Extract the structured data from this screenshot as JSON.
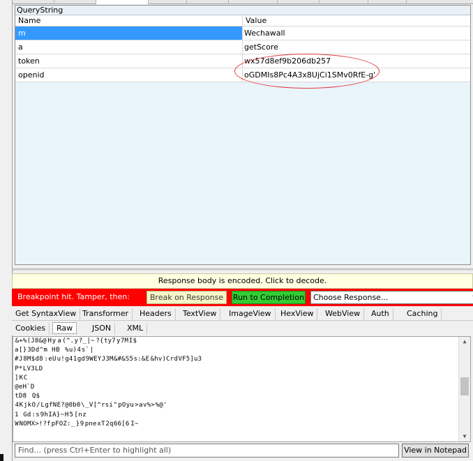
{
  "querystring": {
    "title": "QueryString",
    "columns": [
      "Name",
      "Value"
    ],
    "rows": [
      {
        "name": "m",
        "value": "Wechawall"
      },
      {
        "name": "a",
        "value": "getScore"
      },
      {
        "name": "token",
        "value": "wx57d8ef9b206db257"
      },
      {
        "name": "openid",
        "value": "oGDMIs8Pc4A3x8UjCi1SMv0RfE-g'"
      }
    ]
  },
  "response": {
    "encoded_notice": "Response body is encoded. Click to decode.",
    "breakpoint_label": "Breakpoint hit. Tamper, then:",
    "break_button": "Break on Response",
    "run_button": "Run to Completion",
    "choose_response": "Choose Response...",
    "tabs_row1": [
      "Get SyntaxView",
      "Transformer",
      "Headers",
      "TextView",
      "ImageView",
      "HexView",
      "WebView",
      "Auth",
      "Caching"
    ],
    "tabs_row2": [
      "Cookies",
      "Raw",
      "JSON",
      "XML"
    ],
    "active_tab": "Raw",
    "raw_lines": [
      "\u0001\u0001\u0001&+%\u0001(J8&@\u0001\u0001\u0001\u0001\u0001\u0001\u0001\u0001\u0001H\u0001\u0001\u0001y\u0001\u0001\u0001\u0001\u0001\u0001\u0001\u0001\u0001\u0001a\u0001\u0001\u0001\u0001\u0001\u0001(\u0001^.\u0001y\u0001\u0001\u0001\u0001?_\u0001\u0001|~\u0001\u0001\u0001\u0001\u0001\u0001\u0001\u0001?{\u0001\u0001ty7\u0001\u0001\u0001\u0001\u0001\u0001y\u00017M\u0001\u0001\u0001\u0001I$\u0001\u0001\u0001",
      "a\u0001\u0001[\u0001}\u0001\u0001\u0001\u00013D\u0001d\u0001\u0001^\u0001m \u0001\u0001H\u0001\u0001B\u0001\u0001\u0001 \u0001\u0001\u0001\u0001\u0001%\u0001u)\u0001\u00014\u0001\u0001\u0001\u0001s`\u0001\u0001\u0001|\u0001\u0001\u0001\u0001",
      "#\u0001\u0001J\u0001\u0001\u0001\u00018M$\u0001d8\u0001\u0001\u0001\u0001\u0001\u0001\u0001\u0001:\u0001\u0001eU\u0001\u0001\u0001\u0001\u0001u!\u0001\u0001g4\u0001\u00011\u0001\u0001gd\u0001\u0001\u00019W\u0001EY\u0001J\u00013M\u0001&#&\u0001S5\u0001\u0001s:&\u0001E\u0001\u0001\u0001\u0001\u0001\u0001\u0001&hv)Cr\u0001d\u0001\u0001VF5]u3",
      "\u0001\u0001P*\u0001L\u0001V3\u0001LD\u0001",
      "]\u0001\u0001\u0001\u0001\u0001K\u0001\u0001\u0001C",
      "\u0001@\u0001eH`D\u0001",
      "\u0001\u0001tD8\u0001\u0001\u0001\u0001\u0001\u0001\u0001\u0001  \u0001\u0001Q$\u0001\u0001",
      "\u0001\u0001\u00014\u0001\u0001K\u0001\u0001\u0001jk\u0001\u0001\u0001O\u0001\u0001\u0001\u0001/\u0001\u0001\u0001\u0001L\u0001g\u0001fN\u0001E?\u0001@0b0\u0001\u0001\u0001\\\u0001\u0001_\u0001V\u0001[^\u0001rsi\u0001\u0001\u0001\"\u0001\u0001\u0001\u0001\u0001pO\u0001yu\u0001\u0001\u0001\u0001\u0001\u0001>\u0001a\u0001\u0001v%\u0001>\u0001\u0001\u0001%@\u0001'",
      "1\u0001  \u0001\u0001\u0001\u0001Gd\u0001\u0001\u0001\u0001\u0001:\u0001s\u0001\u0001\u0001\u00019\u0001h\u0001I\u0001A}\u0001~\u0001\u0001\u0001H\u0001\u0001\u0001\u0001\u00015\u0001\u0001\u0001\u0001\u0001\u0001\u0001[\u0001n\u0001\u0001z",
      "\u0001W\u0001\u0001\u0001\u0001NO\u0001MX>!?f\u0001\u0001\u0001\u0001pFOZ:\u0001_\u0001\u0001\u0001\u0001\u0001\u0001}\u0001\u00019\u0001\u0001\u0001\u0001\u0001\u0001\u0001pne\u0001\u0001\u0001\u0001x\u0001T\u0001\u0001\u00012q\u0001\u000166[6\u0001\u0001\u0001\u0001\u0001\u0001\u0001\u0001\u0001I\u0001~\u0001\u0001\u0001\u0001\u0001"
    ],
    "find_placeholder": "Find... (press Ctrl+Enter to highlight all)",
    "view_notepad": "View in Notepad"
  }
}
